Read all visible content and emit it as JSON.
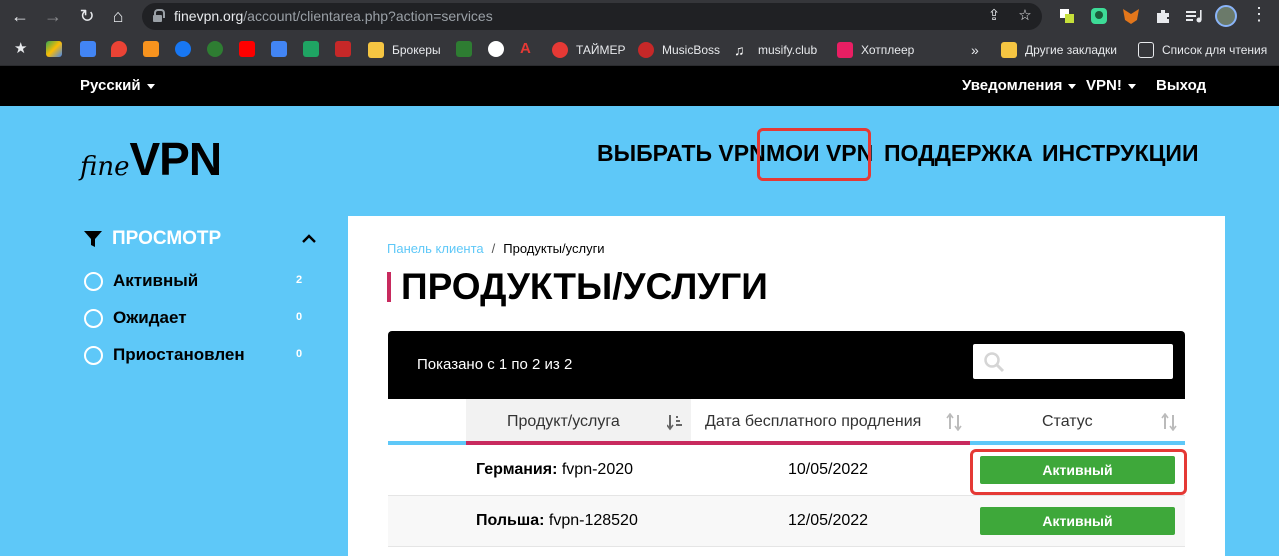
{
  "browser": {
    "url_host": "finevpn.org",
    "url_path": "/account/clientarea.php?action=services",
    "bookmarks": [
      {
        "label": "Брокеры",
        "icon": "folder-icon",
        "color": "#f5c542"
      },
      {
        "label": "ТАЙМЕР",
        "icon": "timer-icon",
        "color": "#e53935"
      },
      {
        "label": "MusicBoss",
        "icon": "musicboss-icon",
        "color": "#c62828"
      },
      {
        "label": "musify.club",
        "icon": "music-note-icon",
        "color": "#ffffff"
      },
      {
        "label": "Хотплеер",
        "icon": "hotplayer-icon",
        "color": "#e91e63"
      },
      {
        "label": "»",
        "icon": "more-bookmarks-icon"
      },
      {
        "label": "Другие закладки",
        "icon": "folder-icon",
        "color": "#f5c542"
      },
      {
        "label": "Список для чтения",
        "icon": "reading-list-icon"
      }
    ]
  },
  "topbar": {
    "language": "Русский",
    "notifications": "Уведомления",
    "vpn_menu": "VPN!",
    "logout": "Выход"
  },
  "header": {
    "logo_fine": "fine",
    "logo_vpn": "VPN",
    "nav": [
      "ВЫБРАТЬ VPN",
      "МОИ VPN",
      "ПОДДЕРЖКА",
      "ИНСТРУКЦИИ"
    ]
  },
  "sidebar": {
    "title": "ПРОСМОТР",
    "filters": [
      {
        "label": "Активный",
        "count": "2"
      },
      {
        "label": "Ожидает",
        "count": "0"
      },
      {
        "label": "Приостановлен",
        "count": "0"
      }
    ]
  },
  "main": {
    "breadcrumb": {
      "home": "Панель клиента",
      "sep": "/",
      "current": "Продукты/услуги"
    },
    "title": "ПРОДУКТЫ/УСЛУГИ",
    "table": {
      "showing": "Показано с 1 по 2 из 2",
      "search_placeholder": "",
      "columns": [
        "Продукт/услуга",
        "Дата бесплатного продления",
        "Статус"
      ],
      "rows": [
        {
          "country": "Германия:",
          "service": " fvpn-2020",
          "date": "10/05/2022",
          "status": "Активный"
        },
        {
          "country": "Польша:",
          "service": " fvpn-128520",
          "date": "12/05/2022",
          "status": "Активный"
        }
      ]
    }
  },
  "colors": {
    "accent_blue": "#5ec8f8",
    "active_green": "#3ea83a",
    "highlight_red": "#e53935",
    "title_bar": "#c82a5e"
  }
}
